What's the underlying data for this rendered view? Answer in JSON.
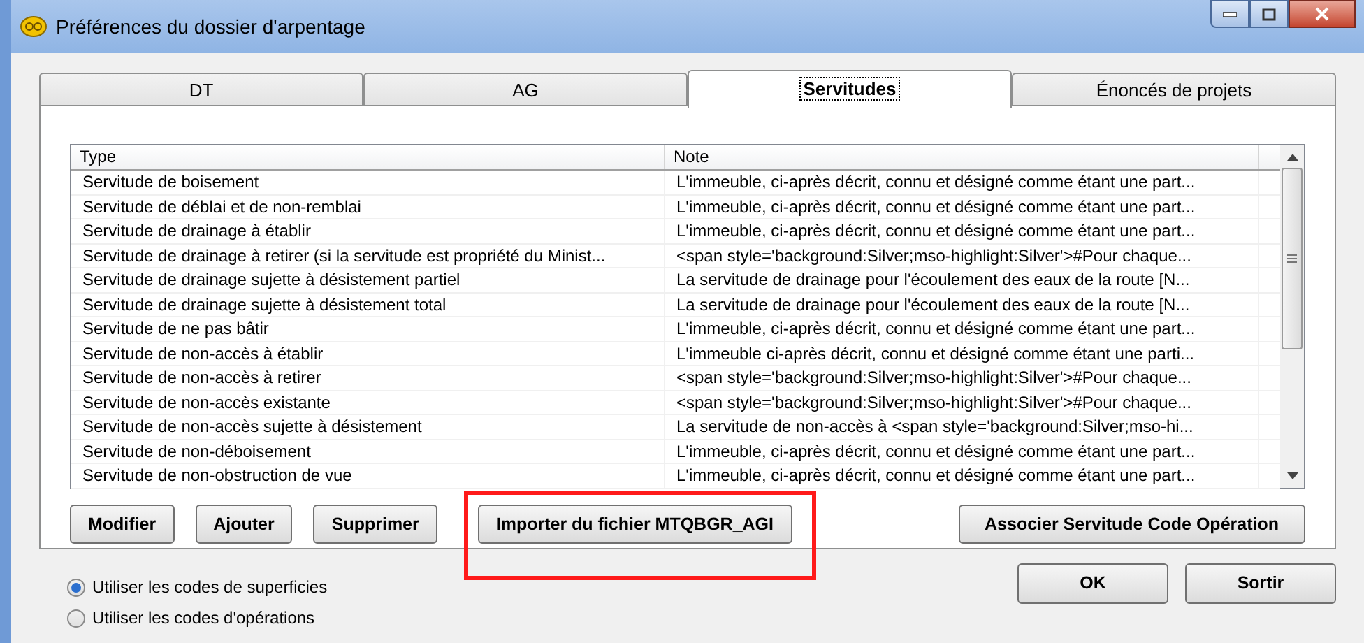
{
  "window": {
    "title": "Préférences du dossier d'arpentage"
  },
  "tabs": [
    {
      "label": "DT",
      "selected": false
    },
    {
      "label": "AG",
      "selected": false
    },
    {
      "label": "Servitudes",
      "selected": true
    },
    {
      "label": "Énoncés de projets",
      "selected": false
    }
  ],
  "table": {
    "columns": [
      "Type",
      "Note"
    ],
    "rows": [
      [
        "Servitude de boisement",
        "L'immeuble, ci-après décrit, connu et désigné comme étant une part..."
      ],
      [
        "Servitude de déblai et de non-remblai",
        "L'immeuble, ci-après décrit, connu et désigné comme étant une part..."
      ],
      [
        "Servitude de drainage à établir",
        "L'immeuble, ci-après décrit, connu et désigné comme étant une part..."
      ],
      [
        "Servitude de drainage à retirer (si la servitude est propriété du Minist...",
        "<span style='background:Silver;mso-highlight:Silver'>#Pour chaque..."
      ],
      [
        "Servitude de drainage sujette à désistement partiel",
        "La servitude de drainage pour l'écoulement des eaux de la route [N..."
      ],
      [
        "Servitude de drainage sujette à désistement total",
        "La servitude de drainage pour l'écoulement des eaux de la route [N..."
      ],
      [
        "Servitude de ne pas bâtir",
        "L'immeuble, ci-après décrit, connu et désigné comme étant une part..."
      ],
      [
        "Servitude de non-accès à établir",
        "L'immeuble ci-après décrit, connu et désigné comme étant une parti..."
      ],
      [
        "Servitude de non-accès à retirer",
        "<span style='background:Silver;mso-highlight:Silver'>#Pour chaque..."
      ],
      [
        "Servitude de non-accès existante",
        "<span style='background:Silver;mso-highlight:Silver'>#Pour chaque..."
      ],
      [
        "Servitude de non-accès sujette à désistement",
        "La servitude de non-accès à <span style='background:Silver;mso-hi..."
      ],
      [
        "Servitude de non-déboisement",
        "L'immeuble, ci-après décrit, connu et désigné comme étant une part..."
      ],
      [
        "Servitude de non-obstruction de vue",
        "L'immeuble, ci-après décrit, connu et désigné comme étant une part..."
      ]
    ]
  },
  "actions": [
    {
      "label": "Modifier",
      "highlighted": false
    },
    {
      "label": "Ajouter",
      "highlighted": false
    },
    {
      "label": "Supprimer",
      "highlighted": false
    },
    {
      "label": "Importer du fichier MTQBGR_AGI",
      "highlighted": true
    },
    {
      "label": "Associer Servitude Code Opération",
      "highlighted": false
    }
  ],
  "options": [
    {
      "label": "Utiliser les codes de superficies",
      "selected": true
    },
    {
      "label": "Utiliser les codes d'opérations",
      "selected": false
    }
  ],
  "buttons": [
    "OK",
    "Sortir"
  ]
}
